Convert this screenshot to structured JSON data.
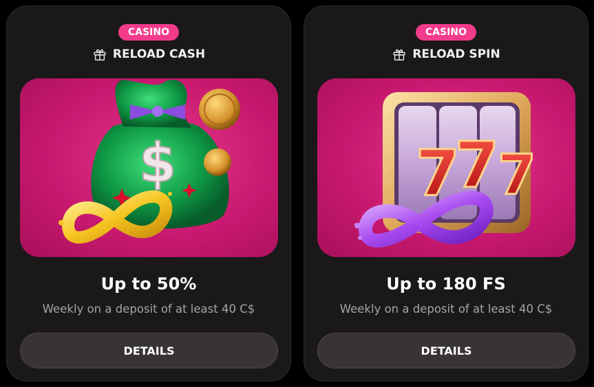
{
  "colors": {
    "page_background": "#000000",
    "card_background": "#1a1819",
    "badge": "#f33b8b",
    "button_background": "#383434",
    "art_background": "#d2247c"
  },
  "cards": [
    {
      "badge": "CASINO",
      "type_icon": "gift-icon",
      "type_label": "RELOAD CASH",
      "illustration": "money-bag-infinity-illustration",
      "amount": "Up to 50%",
      "description": "Weekly on a deposit of at least 40 C$",
      "button_label": "DETAILS"
    },
    {
      "badge": "CASINO",
      "type_icon": "gift-icon",
      "type_label": "RELOAD SPIN",
      "illustration": "slot-777-infinity-illustration",
      "amount": "Up to 180 FS",
      "description": "Weekly on a deposit of at least 40 C$",
      "button_label": "DETAILS"
    }
  ]
}
